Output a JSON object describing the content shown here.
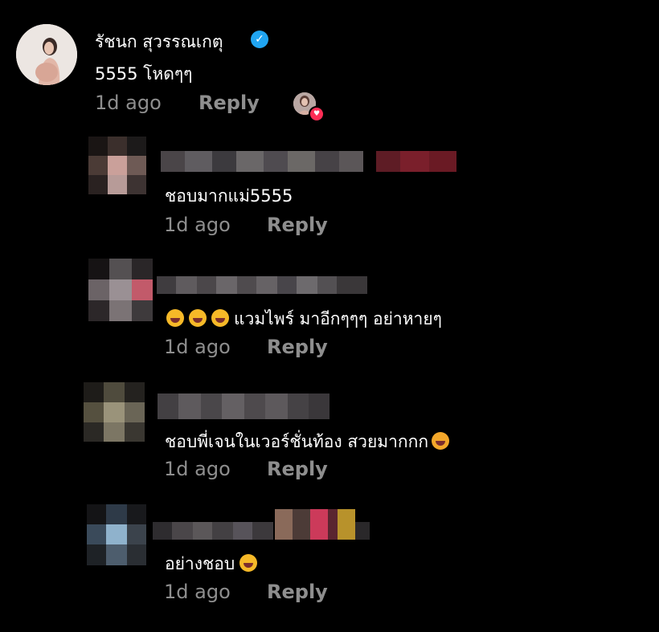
{
  "main_comment": {
    "username": "รัชนก สุวรรณเกตุ",
    "text": "5555 โหดๆๆ",
    "time": "1d ago",
    "reply_label": "Reply",
    "verified_icon": "verified-check-icon",
    "liked_by_author": true
  },
  "replies": [
    {
      "text": "ชอบมากแม่5555",
      "time": "1d ago",
      "reply_label": "Reply"
    },
    {
      "text": "แวมไพร์ มาอีกๆๆๆ อย่าหายๆ",
      "time": "1d ago",
      "reply_label": "Reply",
      "emoji": "rolling-laughing-emoji"
    },
    {
      "text": "ชอบพี่เจนในเวอร์ชั่นท้อง สวยมากกก",
      "time": "1d ago",
      "reply_label": "Reply",
      "emoji": "heart-face-emoji"
    },
    {
      "text": "อย่างชอบ",
      "time": "1d ago",
      "reply_label": "Reply",
      "emoji": "laughing-emoji"
    }
  ],
  "colors": {
    "background": "#000000",
    "meta": "#8e8e8e",
    "verified": "#20a5f2",
    "heart": "#ff2d55"
  }
}
